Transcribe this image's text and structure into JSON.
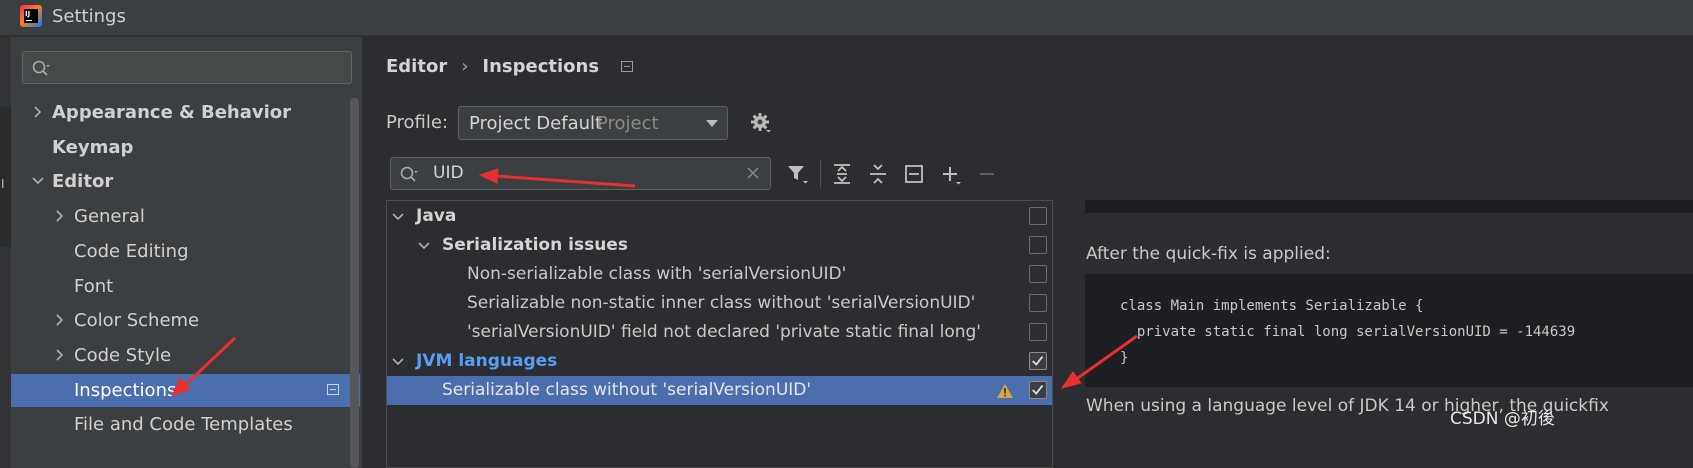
{
  "window": {
    "title": "Settings"
  },
  "sidebar": {
    "search": {
      "value": ""
    },
    "items": [
      {
        "label": "Appearance & Behavior",
        "bold": true,
        "expandable": true,
        "expanded": false
      },
      {
        "label": "Keymap",
        "bold": true,
        "expandable": false
      },
      {
        "label": "Editor",
        "bold": true,
        "expandable": true,
        "expanded": true
      },
      {
        "label": "General",
        "expandable": true
      },
      {
        "label": "Code Editing"
      },
      {
        "label": "Font"
      },
      {
        "label": "Color Scheme",
        "expandable": true
      },
      {
        "label": "Code Style",
        "expandable": true
      },
      {
        "label": "Inspections",
        "selected": true
      },
      {
        "label": "File and Code Templates"
      }
    ],
    "edge_char": "I"
  },
  "breadcrumb": {
    "parent": "Editor",
    "separator": "›",
    "current": "Inspections"
  },
  "profile": {
    "label": "Profile:",
    "value": "Project Default",
    "scope": "Project"
  },
  "filter": {
    "value": "UID"
  },
  "inspections": [
    {
      "label": "Java",
      "level": 0,
      "bold": true,
      "checked": false,
      "color": "#d4d4d4"
    },
    {
      "label": "Serialization issues",
      "level": 1,
      "bold": true,
      "checked": false,
      "color": "#d4d4d4"
    },
    {
      "label": "Non-serializable class with 'serialVersionUID'",
      "level": 2,
      "checked": false
    },
    {
      "label": "Serializable non-static inner class without 'serialVersionUID'",
      "level": 2,
      "checked": false
    },
    {
      "label": "'serialVersionUID' field not declared 'private static final long'",
      "level": 2,
      "checked": false
    },
    {
      "label": "JVM languages",
      "level": 0,
      "bold": true,
      "checked": true,
      "color": "#589df6"
    },
    {
      "label": "Serializable class without 'serialVersionUID'",
      "level": 1,
      "checked": true,
      "selected": true,
      "warning": true
    }
  ],
  "description": {
    "after_fix": "After the quick-fix is applied:",
    "code": [
      "class Main implements Serializable {",
      "  private static final long serialVersionUID = -144639",
      "}"
    ],
    "trailing": "When using a language level of JDK 14 or higher, the quickfix"
  },
  "watermark": "CSDN @初後",
  "colors": {
    "accent": "#4b6eaf",
    "link_blue": "#589df6",
    "arrow_red": "#e8302e",
    "warning": "#d9a343"
  }
}
